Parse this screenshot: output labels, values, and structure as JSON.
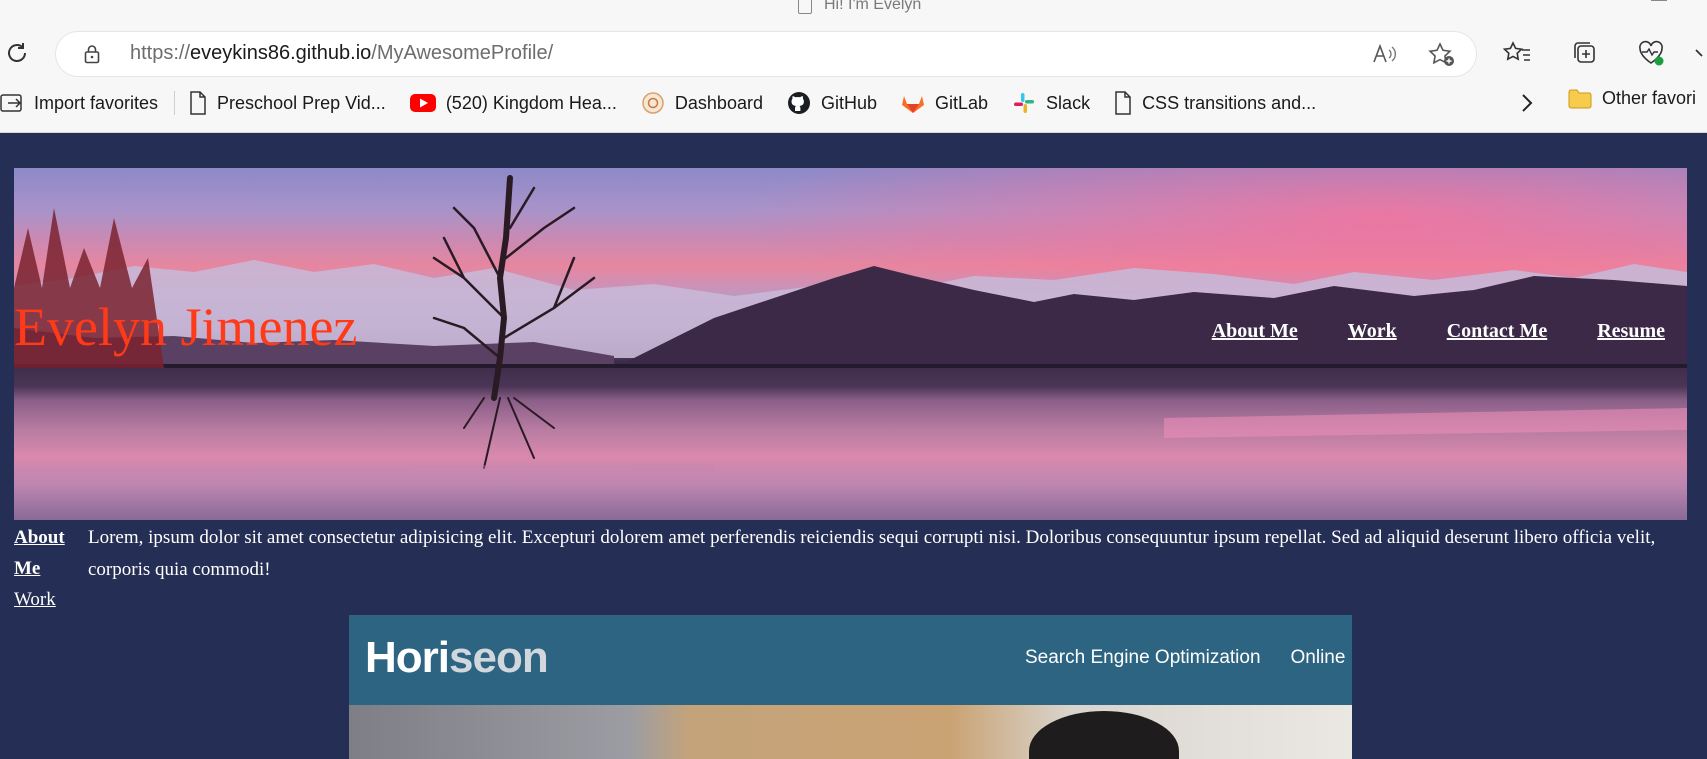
{
  "browser": {
    "tab_title": "Hi! I'm Evelyn",
    "url_scheme": "https://",
    "url_host": "eveykins86.github.io",
    "url_path": "/MyAwesomeProfile/",
    "bookmarks": [
      {
        "label": "Import favorites",
        "icon": "import-icon"
      },
      {
        "label": "Preschool Prep Vid...",
        "icon": "page-icon"
      },
      {
        "label": "(520) Kingdom Hea...",
        "icon": "youtube-icon"
      },
      {
        "label": "Dashboard",
        "icon": "dashboard-icon"
      },
      {
        "label": "GitHub",
        "icon": "github-icon"
      },
      {
        "label": "GitLab",
        "icon": "gitlab-icon"
      },
      {
        "label": "Slack",
        "icon": "slack-icon"
      },
      {
        "label": "CSS transitions and...",
        "icon": "page-icon"
      }
    ],
    "other_favorites": "Other favori"
  },
  "hero": {
    "name": "Evelyn Jimenez",
    "nav": [
      "About Me",
      "Work",
      "Contact Me",
      "Resume"
    ]
  },
  "side_nav": {
    "about": "About Me",
    "work": "Work"
  },
  "about": {
    "text": "Lorem, ipsum dolor sit amet consectetur adipisicing elit. Excepturi dolorem amet perferendis reiciendis sequi corrupti nisi. Doloribus consequuntur ipsum repellat. Sed ad aliquid deserunt libero officia velit, corporis quia commodi!"
  },
  "work": {
    "logo_a": "Hori",
    "logo_b": "seon",
    "nav": [
      "Search Engine Optimization",
      "Online Re"
    ]
  },
  "colors": {
    "page_bg": "#252f55",
    "name_color": "#ff3a18",
    "work_banner": "#2c6482"
  }
}
